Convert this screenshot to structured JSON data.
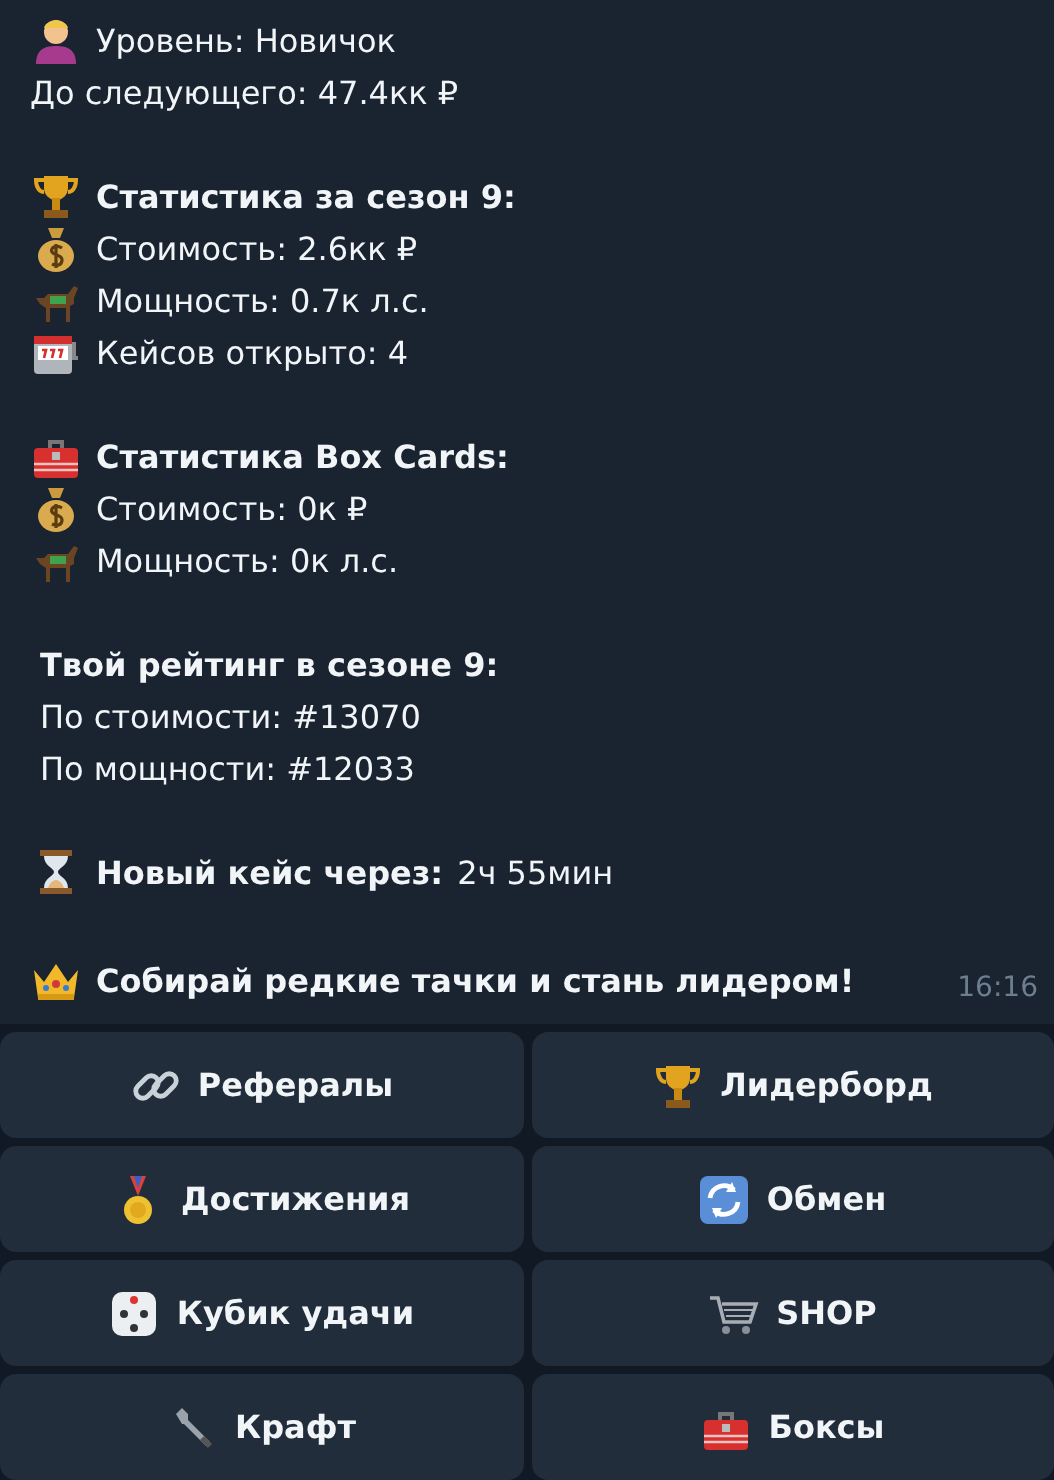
{
  "message": {
    "level": {
      "label": "Уровень: Новичок",
      "next": "До следующего: 47.4кк ₽"
    },
    "season_stats": {
      "title": "Статистика за сезон 9:",
      "value": "Стоимость: 2.6кк ₽",
      "power": "Мощность: 0.7к л.с.",
      "cases": "Кейсов открыто: 4"
    },
    "box_stats": {
      "title": "Статистика Box Cards:",
      "value": "Стоимость: 0к ₽",
      "power": "Мощность: 0к л.с."
    },
    "rating": {
      "title": "Твой рейтинг в сезоне 9:",
      "by_value": "По стоимости: #13070",
      "by_power": "По мощности: #12033"
    },
    "next_case": {
      "label": "Новый кейс через:",
      "value": "2ч 55мин"
    },
    "motto": "Собирай редкие тачки и стань лидером!",
    "time": "16:16"
  },
  "buttons": [
    {
      "label": "Рефералы"
    },
    {
      "label": "Лидерборд"
    },
    {
      "label": "Достижения"
    },
    {
      "label": "Обмен"
    },
    {
      "label": "Кубик удачи"
    },
    {
      "label": "SHOP"
    },
    {
      "label": "Крафт"
    },
    {
      "label": "Боксы"
    }
  ]
}
